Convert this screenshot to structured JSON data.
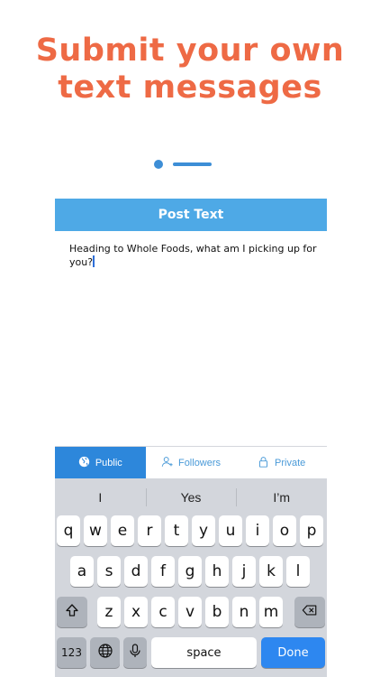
{
  "headline": {
    "line1": "Submit your own",
    "line2": "text messages"
  },
  "pager": {
    "total": 2,
    "current": 1
  },
  "nav": {
    "title": "Post Text"
  },
  "compose": {
    "text": "Heading to Whole Foods, what am I picking up for you?"
  },
  "audience": {
    "tabs": [
      {
        "label": "Public",
        "icon": "globe-icon",
        "selected": true
      },
      {
        "label": "Followers",
        "icon": "person-icon",
        "selected": false
      },
      {
        "label": "Private",
        "icon": "lock-icon",
        "selected": false
      }
    ]
  },
  "keyboard": {
    "suggestions": [
      "I",
      "Yes",
      "I’m"
    ],
    "row1": [
      "q",
      "w",
      "e",
      "r",
      "t",
      "y",
      "u",
      "i",
      "o",
      "p"
    ],
    "row2": [
      "a",
      "s",
      "d",
      "f",
      "g",
      "h",
      "j",
      "k",
      "l"
    ],
    "row3": [
      "z",
      "x",
      "c",
      "v",
      "b",
      "n",
      "m"
    ],
    "numbers_label": "123",
    "space_label": "space",
    "done_label": "Done",
    "icons": {
      "shift": "shift-icon",
      "backspace": "backspace-icon",
      "globe": "globe-icon",
      "mic": "microphone-icon"
    }
  },
  "colors": {
    "headline": "#ee6a45",
    "navbar": "#4ea9e6",
    "accent": "#2d87db",
    "pager": "#3d8ed6"
  }
}
